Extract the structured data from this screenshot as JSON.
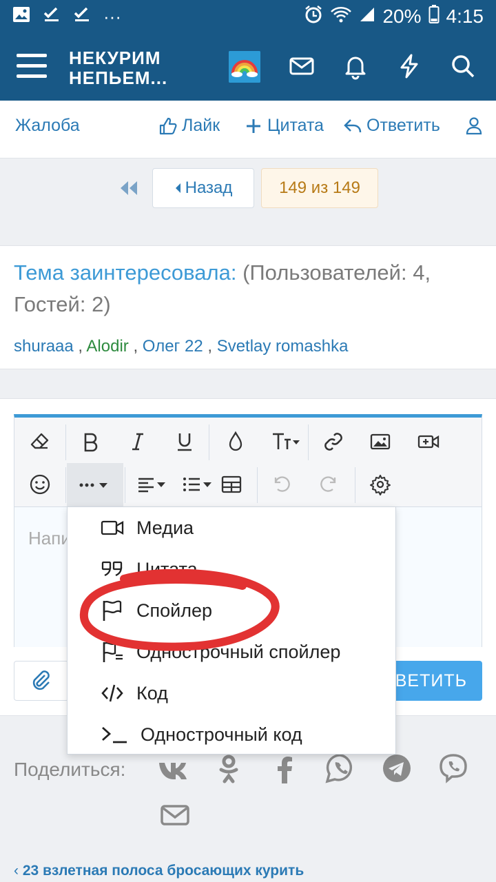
{
  "status": {
    "battery": "20%",
    "time": "4:15",
    "more": "···"
  },
  "brand": {
    "line1": "НЕКУРИМ",
    "line2": "НЕПЬЕМ..."
  },
  "actions": {
    "complain": "Жалоба",
    "like": "Лайк",
    "quote": "Цитата",
    "reply": "Ответить"
  },
  "pager": {
    "back": "Назад",
    "count": "149 из 149"
  },
  "watchers": {
    "label": "Тема заинтересовала:",
    "count": " (Пользователей: 4, Гостей: 2)",
    "users": [
      "shuraaa",
      "Alodir",
      "Олег 22",
      "Svetlay romashka"
    ],
    "sep": " , "
  },
  "editor": {
    "placeholder": "Напишите ответ...",
    "submit": "ОТВЕТИТЬ"
  },
  "menu": {
    "items": [
      {
        "label": "Медиа",
        "icon": "video-camera-icon"
      },
      {
        "label": "Цитата",
        "icon": "quote-icon"
      },
      {
        "label": "Спойлер",
        "icon": "flag-icon"
      },
      {
        "label": "Однострочный спойлер",
        "icon": "flag-lines-icon"
      },
      {
        "label": "Код",
        "icon": "code-icon"
      },
      {
        "label": "Однострочный код",
        "icon": "terminal-icon"
      }
    ]
  },
  "share": {
    "label": "Поделиться:"
  },
  "breadcrumb": {
    "text": "23 взлетная полоса бросающих курить"
  },
  "colors": {
    "header": "#185886",
    "link": "#2b7ab5",
    "accent": "#3d9ad6",
    "annotation": "#e23232"
  }
}
